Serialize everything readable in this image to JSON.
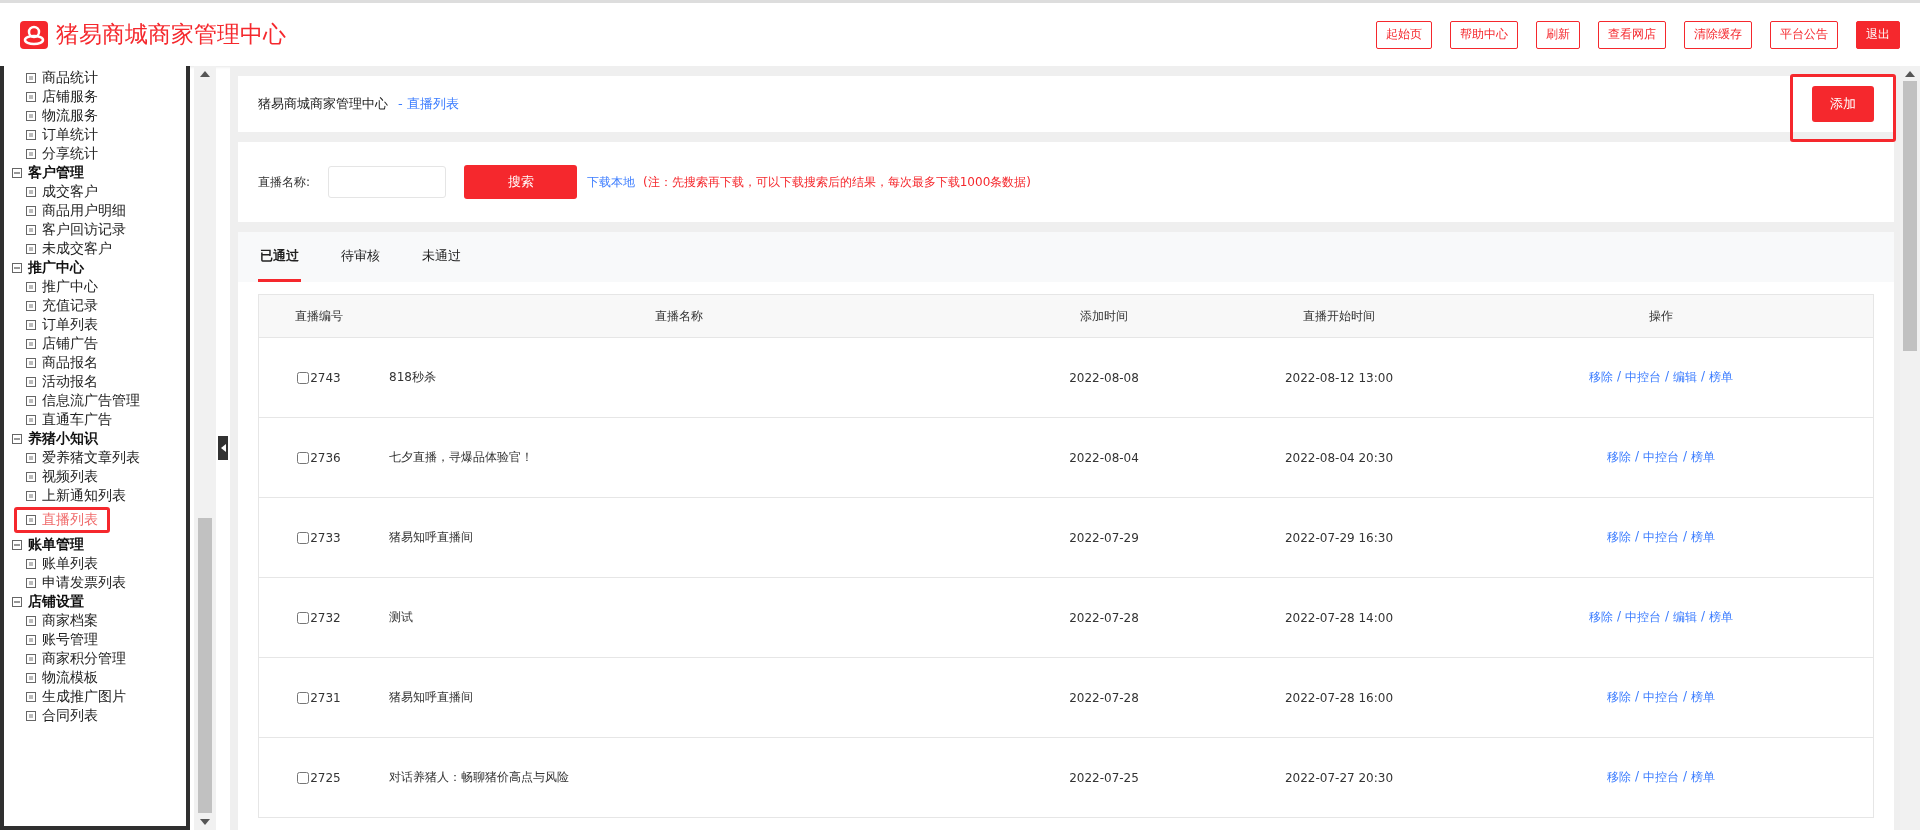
{
  "header": {
    "title": "猪易商城商家管理中心",
    "buttons": [
      {
        "label": "起始页",
        "kind": "outline"
      },
      {
        "label": "帮助中心",
        "kind": "outline"
      },
      {
        "label": "刷新",
        "kind": "outline"
      },
      {
        "label": "查看网店",
        "kind": "outline"
      },
      {
        "label": "清除缓存",
        "kind": "outline"
      },
      {
        "label": "平台公告",
        "kind": "outline"
      },
      {
        "label": "退出",
        "kind": "filled"
      }
    ]
  },
  "sidebar": {
    "groups": [
      {
        "children": [
          {
            "label": "商品统计",
            "selected": false,
            "highlighted": false
          },
          {
            "label": "店铺服务",
            "selected": false,
            "highlighted": false
          },
          {
            "label": "物流服务",
            "selected": false,
            "highlighted": false
          },
          {
            "label": "订单统计",
            "selected": false,
            "highlighted": false
          },
          {
            "label": "分享统计",
            "selected": false,
            "highlighted": false
          }
        ]
      },
      {
        "title": "客户管理",
        "children": [
          {
            "label": "成交客户",
            "selected": false,
            "highlighted": false
          },
          {
            "label": "商品用户明细",
            "selected": false,
            "highlighted": false
          },
          {
            "label": "客户回访记录",
            "selected": false,
            "highlighted": false
          },
          {
            "label": "未成交客户",
            "selected": false,
            "highlighted": false
          }
        ]
      },
      {
        "title": "推广中心",
        "children": [
          {
            "label": "推广中心",
            "selected": false,
            "highlighted": false
          },
          {
            "label": "充值记录",
            "selected": false,
            "highlighted": false
          },
          {
            "label": "订单列表",
            "selected": false,
            "highlighted": false
          },
          {
            "label": "店铺广告",
            "selected": false,
            "highlighted": false
          },
          {
            "label": "商品报名",
            "selected": false,
            "highlighted": false
          },
          {
            "label": "活动报名",
            "selected": false,
            "highlighted": false
          },
          {
            "label": "信息流广告管理",
            "selected": false,
            "highlighted": false
          },
          {
            "label": "直通车广告",
            "selected": false,
            "highlighted": false
          }
        ]
      },
      {
        "title": "养猪小知识",
        "children": [
          {
            "label": "爱养猪文章列表",
            "selected": false,
            "highlighted": false
          },
          {
            "label": "视频列表",
            "selected": false,
            "highlighted": false
          },
          {
            "label": "上新通知列表",
            "selected": false,
            "highlighted": false
          },
          {
            "label": "直播列表",
            "selected": true,
            "highlighted": true
          }
        ]
      },
      {
        "title": "账单管理",
        "children": [
          {
            "label": "账单列表",
            "selected": false,
            "highlighted": false
          },
          {
            "label": "申请发票列表",
            "selected": false,
            "highlighted": false
          }
        ]
      },
      {
        "title": "店铺设置",
        "children": [
          {
            "label": "商家档案",
            "selected": false,
            "highlighted": false
          },
          {
            "label": "账号管理",
            "selected": false,
            "highlighted": false
          },
          {
            "label": "商家积分管理",
            "selected": false,
            "highlighted": false
          },
          {
            "label": "物流模板",
            "selected": false,
            "highlighted": false
          },
          {
            "label": "生成推广图片",
            "selected": false,
            "highlighted": false
          },
          {
            "label": "合同列表",
            "selected": false,
            "highlighted": false
          }
        ]
      }
    ]
  },
  "breadcrumb": {
    "root": "猪易商城商家管理中心",
    "current": "- 直播列表"
  },
  "add_button": {
    "label": "添加",
    "highlighted": true
  },
  "search": {
    "label": "直播名称:",
    "search_button": "搜索",
    "download_link": "下载本地",
    "note": "(注：先搜索再下载，可以下载搜索后的结果，每次最多下载1000条数据)"
  },
  "tabs": [
    {
      "label": "已通过",
      "selected": true
    },
    {
      "label": "待审核",
      "selected": false
    },
    {
      "label": "未通过",
      "selected": false
    }
  ],
  "table": {
    "columns": [
      "直播编号",
      "直播名称",
      "添加时间",
      "直播开始时间",
      "操作"
    ],
    "separator": "/",
    "rows": [
      {
        "id": "2743",
        "checked": false,
        "name": "818秒杀",
        "added": "2022-08-08",
        "start": "2022-08-12 13:00",
        "actions": [
          "移除",
          "中控台",
          "编辑",
          "榜单"
        ]
      },
      {
        "id": "2736",
        "checked": false,
        "name": "七夕直播，寻爆品体验官！",
        "added": "2022-08-04",
        "start": "2022-08-04 20:30",
        "actions": [
          "移除",
          "中控台",
          "榜单"
        ]
      },
      {
        "id": "2733",
        "checked": false,
        "name": "猪易知呼直播间",
        "added": "2022-07-29",
        "start": "2022-07-29 16:30",
        "actions": [
          "移除",
          "中控台",
          "榜单"
        ]
      },
      {
        "id": "2732",
        "checked": false,
        "name": "测试",
        "added": "2022-07-28",
        "start": "2022-07-28 14:00",
        "actions": [
          "移除",
          "中控台",
          "编辑",
          "榜单"
        ]
      },
      {
        "id": "2731",
        "checked": false,
        "name": "猪易知呼直播间",
        "added": "2022-07-28",
        "start": "2022-07-28 16:00",
        "actions": [
          "移除",
          "中控台",
          "榜单"
        ]
      },
      {
        "id": "2725",
        "checked": false,
        "name": "对话养猪人：畅聊猪价高点与风险",
        "added": "2022-07-25",
        "start": "2022-07-27 20:30",
        "actions": [
          "移除",
          "中控台",
          "榜单"
        ]
      }
    ]
  }
}
